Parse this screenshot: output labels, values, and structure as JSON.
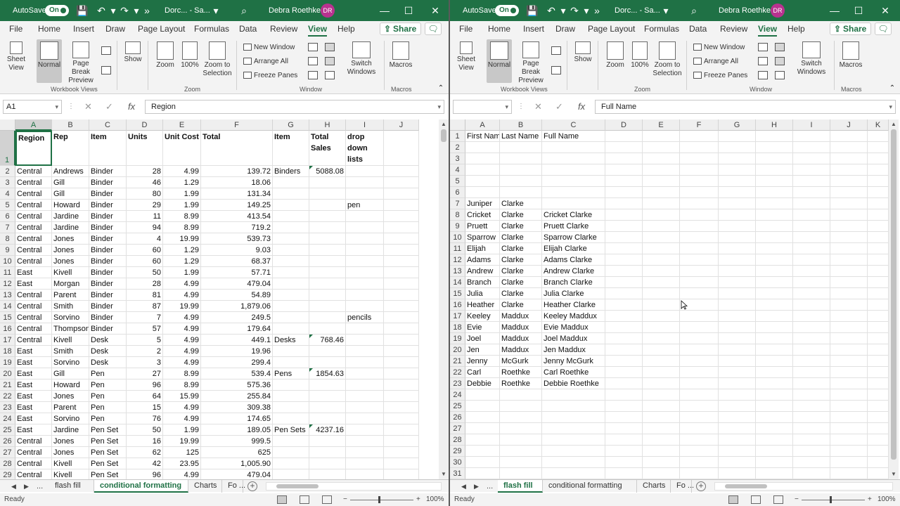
{
  "left": {
    "title": {
      "autosave": "AutoSave",
      "toggle": "On",
      "doc": "Dorc... - Sa...",
      "user": "Debra Roethke",
      "initials": "DR"
    },
    "menu": [
      "File",
      "Home",
      "Insert",
      "Draw",
      "Page Layout",
      "Formulas",
      "Data",
      "Review",
      "View",
      "Help"
    ],
    "menu_active": "View",
    "share": "Share",
    "ribbon": {
      "sheet_view": "Sheet View",
      "normal": "Normal",
      "page_break": "Page Break Preview",
      "show": "Show",
      "zoom": "Zoom",
      "zoom100": "100%",
      "zoom_sel": "Zoom to Selection",
      "new_window": "New Window",
      "arrange_all": "Arrange All",
      "freeze": "Freeze Panes",
      "switch": "Switch Windows",
      "macros": "Macros",
      "g_workbook": "Workbook Views",
      "g_zoom": "Zoom",
      "g_window": "Window",
      "g_macros": "Macros"
    },
    "namebox": "A1",
    "formula": "Region",
    "columns": [
      "A",
      "B",
      "C",
      "D",
      "E",
      "F",
      "G",
      "H",
      "I",
      "J"
    ],
    "header_row": [
      "Region",
      "Rep",
      "Item",
      "Units",
      "Unit Cost",
      "Total",
      "Item",
      "Total Sales",
      "drop down lists",
      ""
    ],
    "rows": [
      [
        "2",
        "Central",
        "Andrews",
        "Binder",
        "28",
        "4.99",
        "139.72",
        "Binders",
        "5088.08",
        ""
      ],
      [
        "3",
        "Central",
        "Gill",
        "Binder",
        "46",
        "1.29",
        "18.06",
        "",
        "",
        ""
      ],
      [
        "4",
        "Central",
        "Gill",
        "Binder",
        "80",
        "1.99",
        "131.34",
        "",
        "",
        ""
      ],
      [
        "5",
        "Central",
        "Howard",
        "Binder",
        "29",
        "1.99",
        "149.25",
        "",
        "",
        "pen"
      ],
      [
        "6",
        "Central",
        "Jardine",
        "Binder",
        "11",
        "8.99",
        "413.54",
        "",
        "",
        ""
      ],
      [
        "7",
        "Central",
        "Jardine",
        "Binder",
        "94",
        "8.99",
        "719.2",
        "",
        "",
        ""
      ],
      [
        "8",
        "Central",
        "Jones",
        "Binder",
        "4",
        "19.99",
        "539.73",
        "",
        "",
        ""
      ],
      [
        "9",
        "Central",
        "Jones",
        "Binder",
        "60",
        "1.29",
        "9.03",
        "",
        "",
        ""
      ],
      [
        "10",
        "Central",
        "Jones",
        "Binder",
        "60",
        "1.29",
        "68.37",
        "",
        "",
        ""
      ],
      [
        "11",
        "East",
        "Kivell",
        "Binder",
        "50",
        "1.99",
        "57.71",
        "",
        "",
        ""
      ],
      [
        "12",
        "East",
        "Morgan",
        "Binder",
        "28",
        "4.99",
        "479.04",
        "",
        "",
        ""
      ],
      [
        "13",
        "Central",
        "Parent",
        "Binder",
        "81",
        "4.99",
        "54.89",
        "",
        "",
        ""
      ],
      [
        "14",
        "Central",
        "Smith",
        "Binder",
        "87",
        "19.99",
        "1,879.06",
        "",
        "",
        ""
      ],
      [
        "15",
        "Central",
        "Sorvino",
        "Binder",
        "7",
        "4.99",
        "249.5",
        "",
        "",
        "pencils"
      ],
      [
        "16",
        "Central",
        "Thompson",
        "Binder",
        "57",
        "4.99",
        "179.64",
        "",
        "",
        ""
      ],
      [
        "17",
        "Central",
        "Kivell",
        "Desk",
        "5",
        "4.99",
        "449.1",
        "Desks",
        "768.46",
        ""
      ],
      [
        "18",
        "East",
        "Smith",
        "Desk",
        "2",
        "4.99",
        "19.96",
        "",
        "",
        ""
      ],
      [
        "19",
        "East",
        "Sorvino",
        "Desk",
        "3",
        "4.99",
        "299.4",
        "",
        "",
        ""
      ],
      [
        "20",
        "East",
        "Gill",
        "Pen",
        "27",
        "8.99",
        "539.4",
        "Pens",
        "1854.63",
        ""
      ],
      [
        "21",
        "East",
        "Howard",
        "Pen",
        "96",
        "8.99",
        "575.36",
        "",
        "",
        ""
      ],
      [
        "22",
        "East",
        "Jones",
        "Pen",
        "64",
        "15.99",
        "255.84",
        "",
        "",
        ""
      ],
      [
        "23",
        "East",
        "Parent",
        "Pen",
        "15",
        "4.99",
        "309.38",
        "",
        "",
        ""
      ],
      [
        "24",
        "East",
        "Sorvino",
        "Pen",
        "76",
        "4.99",
        "174.65",
        "",
        "",
        ""
      ],
      [
        "25",
        "East",
        "Jardine",
        "Pen Set",
        "50",
        "1.99",
        "189.05",
        "Pen Sets",
        "4237.16",
        ""
      ],
      [
        "26",
        "Central",
        "Jones",
        "Pen Set",
        "16",
        "19.99",
        "999.5",
        "",
        "",
        ""
      ],
      [
        "27",
        "Central",
        "Jones",
        "Pen Set",
        "62",
        "125",
        "625",
        "",
        "",
        ""
      ],
      [
        "28",
        "Central",
        "Kivell",
        "Pen Set",
        "42",
        "23.95",
        "1,005.90",
        "",
        "",
        ""
      ],
      [
        "29",
        "Central",
        "Kivell",
        "Pen Set",
        "96",
        "4.99",
        "479.04",
        "",
        "",
        ""
      ]
    ],
    "tabs": [
      "flash fill",
      "conditional formatting",
      "Charts",
      "Fo ..."
    ],
    "active_tab": "conditional formatting",
    "status": "Ready",
    "zoom": "100%"
  },
  "right": {
    "title": {
      "autosave": "AutoSave",
      "toggle": "On",
      "doc": "Dorc... - Sa...",
      "user": "Debra Roethke",
      "initials": "DR"
    },
    "menu": [
      "File",
      "Home",
      "Insert",
      "Draw",
      "Page Layout",
      "Formulas",
      "Data",
      "Review",
      "View",
      "Help"
    ],
    "menu_active": "View",
    "share": "Share",
    "ribbon": {
      "sheet_view": "Sheet View",
      "normal": "Normal",
      "page_break": "Page Break Preview",
      "show": "Show",
      "zoom": "Zoom",
      "zoom100": "100%",
      "zoom_sel": "Zoom to Selection",
      "new_window": "New Window",
      "arrange_all": "Arrange All",
      "freeze": "Freeze Panes",
      "switch": "Switch Windows",
      "macros": "Macros",
      "g_workbook": "Workbook Views",
      "g_zoom": "Zoom",
      "g_window": "Window",
      "g_macros": "Macros"
    },
    "namebox": "",
    "formula": "Full Name",
    "columns": [
      "A",
      "B",
      "C",
      "D",
      "E",
      "F",
      "G",
      "H",
      "I",
      "J",
      "K"
    ],
    "rows": [
      [
        "1",
        "First Nam",
        "Last Name",
        "Full Name"
      ],
      [
        "2",
        "",
        "",
        ""
      ],
      [
        "3",
        "",
        "",
        ""
      ],
      [
        "4",
        "",
        "",
        ""
      ],
      [
        "5",
        "",
        "",
        ""
      ],
      [
        "6",
        "",
        "",
        ""
      ],
      [
        "7",
        "Juniper",
        "Clarke",
        ""
      ],
      [
        "8",
        "Cricket",
        "Clarke",
        "Cricket Clarke"
      ],
      [
        "9",
        "Pruett",
        "Clarke",
        "Pruett Clarke"
      ],
      [
        "10",
        "Sparrow",
        "Clarke",
        "Sparrow Clarke"
      ],
      [
        "11",
        "Elijah",
        "Clarke",
        "Elijah Clarke"
      ],
      [
        "12",
        "Adams",
        "Clarke",
        "Adams Clarke"
      ],
      [
        "13",
        "Andrew",
        "Clarke",
        "Andrew Clarke"
      ],
      [
        "14",
        "Branch",
        "Clarke",
        "Branch Clarke"
      ],
      [
        "15",
        "Julia",
        "Clarke",
        "Julia Clarke"
      ],
      [
        "16",
        "Heather",
        "Clarke",
        "Heather Clarke"
      ],
      [
        "17",
        "Keeley",
        "Maddux",
        "Keeley Maddux"
      ],
      [
        "18",
        "Evie",
        "Maddux",
        "Evie Maddux"
      ],
      [
        "19",
        "Joel",
        "Maddux",
        "Joel Maddux"
      ],
      [
        "20",
        "Jen",
        "Maddux",
        "Jen Maddux"
      ],
      [
        "21",
        "Jenny",
        "McGurk",
        "Jenny McGurk"
      ],
      [
        "22",
        "Carl",
        "Roethke",
        "Carl Roethke"
      ],
      [
        "23",
        "Debbie",
        "Roethke",
        "Debbie Roethke"
      ],
      [
        "24",
        "",
        "",
        ""
      ],
      [
        "25",
        "",
        "",
        ""
      ],
      [
        "26",
        "",
        "",
        ""
      ],
      [
        "27",
        "",
        "",
        ""
      ],
      [
        "28",
        "",
        "",
        ""
      ],
      [
        "29",
        "",
        "",
        ""
      ],
      [
        "30",
        "",
        "",
        ""
      ],
      [
        "31",
        "",
        "",
        ""
      ]
    ],
    "tabs": [
      "flash fill",
      "conditional formatting",
      "Charts",
      "Fo ..."
    ],
    "active_tab": "flash fill",
    "status": "Ready",
    "zoom": "100%"
  },
  "colors": {
    "accent": "#1f7145",
    "avatar": "#b8328f"
  }
}
